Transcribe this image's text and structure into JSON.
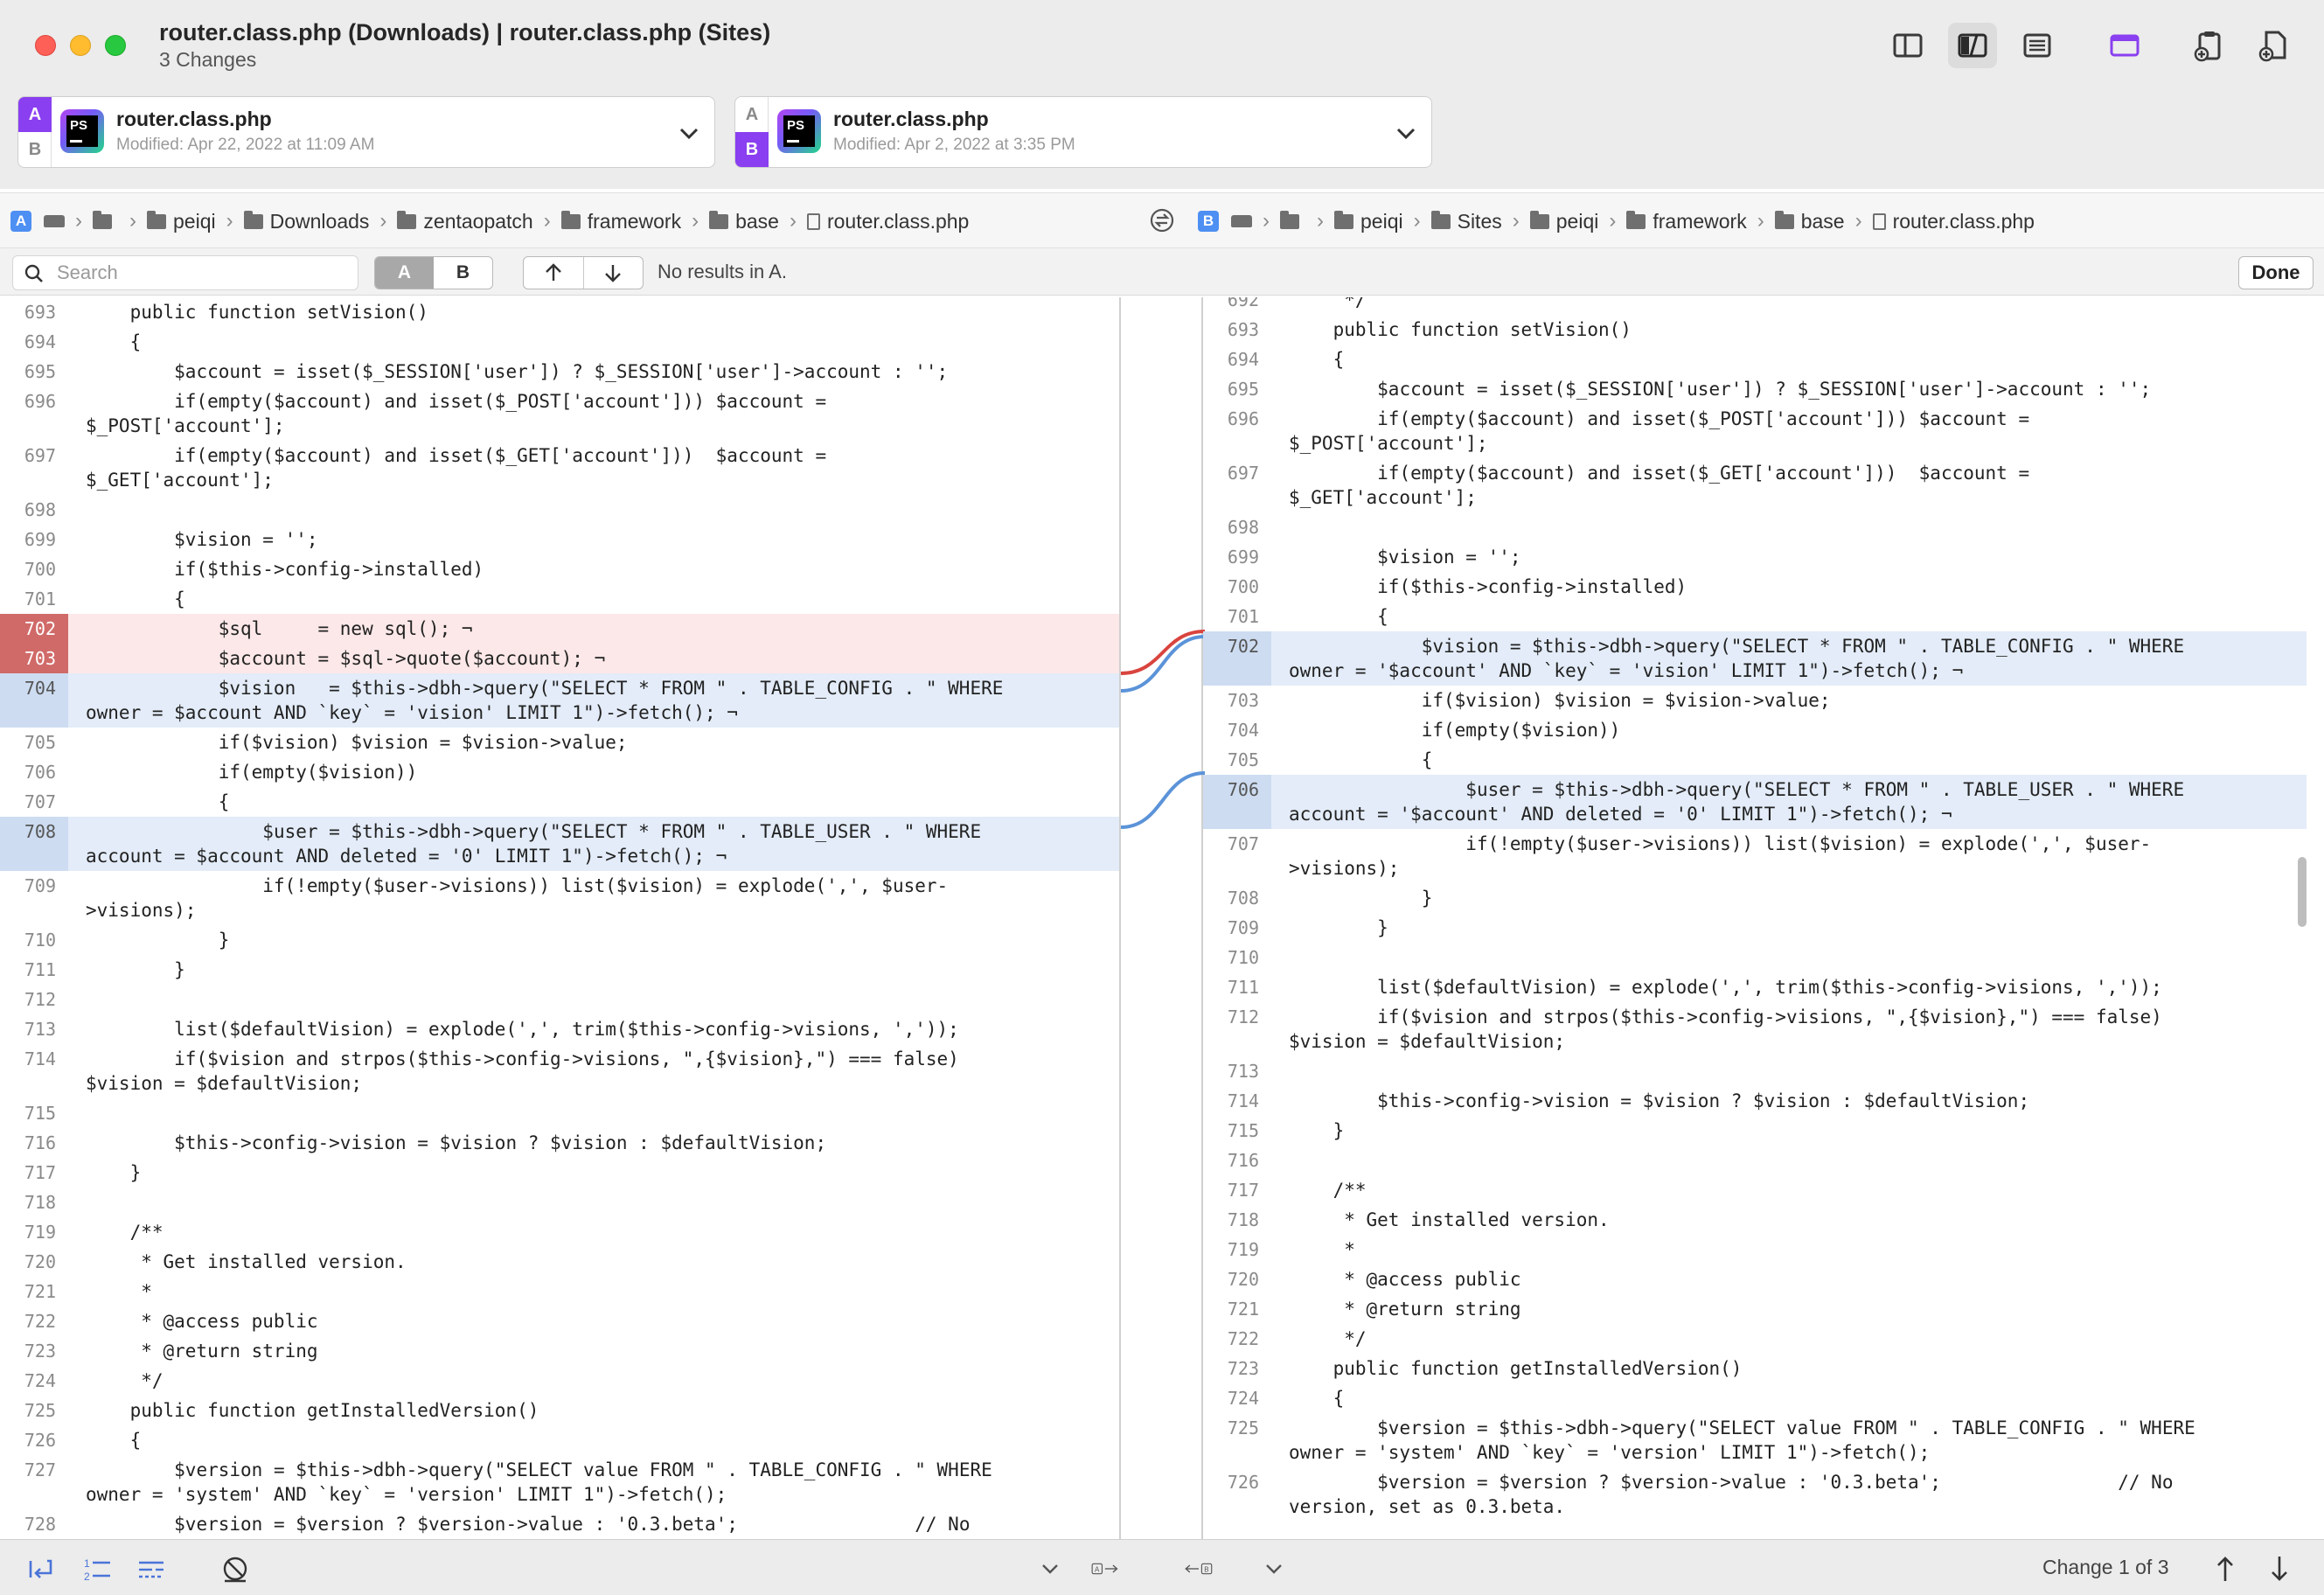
{
  "window": {
    "title": "router.class.php (Downloads) | router.class.php (Sites)",
    "subtitle": "3 Changes"
  },
  "toolbar": {
    "icons": [
      "sidebar-layout-icon",
      "side-by-side-layout-icon",
      "unified-layout-icon",
      "window-layout-icon",
      "clipboard-add-icon",
      "document-add-icon"
    ]
  },
  "file_a": {
    "name": "router.class.php",
    "modified": "Modified: Apr 22, 2022 at 11:09 AM",
    "selected": "A"
  },
  "file_b": {
    "name": "router.class.php",
    "modified": "Modified: Apr 2, 2022 at 3:35 PM",
    "selected": "B"
  },
  "path_a": {
    "badge": "A",
    "crumbs": [
      "peiqi",
      "Downloads",
      "zentaopatch",
      "framework",
      "base",
      "router.class.php"
    ]
  },
  "path_b": {
    "badge": "B",
    "crumbs": [
      "peiqi",
      "Sites",
      "peiqi",
      "framework",
      "base",
      "router.class.php"
    ]
  },
  "search": {
    "placeholder": "Search",
    "seg_a": "A",
    "seg_b": "B",
    "status": "No results in A.",
    "done_label": "Done"
  },
  "pane_a": [
    {
      "n": "693",
      "t": "    public function setVision()"
    },
    {
      "n": "694",
      "t": "    {"
    },
    {
      "n": "695",
      "t": "        $account = isset($_SESSION['user']) ? $_SESSION['user']->account : '';"
    },
    {
      "n": "696",
      "t": "        if(empty($account) and isset($_POST['account'])) $account =\n$_POST['account'];"
    },
    {
      "n": "697",
      "t": "        if(empty($account) and isset($_GET['account']))  $account =\n$_GET['account'];"
    },
    {
      "n": "698",
      "t": ""
    },
    {
      "n": "699",
      "t": "        $vision = '';"
    },
    {
      "n": "700",
      "t": "        if($this->config->installed)"
    },
    {
      "n": "701",
      "t": "        {"
    },
    {
      "n": "702",
      "t": "            $sql     = new sql(); ¬",
      "k": "del"
    },
    {
      "n": "703",
      "t": "            $account = $sql->quote($account); ¬",
      "k": "del"
    },
    {
      "n": "704",
      "t": "            $vision   = $this->dbh->query(\"SELECT * FROM \" . TABLE_CONFIG . \" WHERE\nowner = $account AND `key` = 'vision' LIMIT 1\")->fetch(); ¬",
      "k": "chg"
    },
    {
      "n": "705",
      "t": "            if($vision) $vision = $vision->value;"
    },
    {
      "n": "706",
      "t": "            if(empty($vision))"
    },
    {
      "n": "707",
      "t": "            {"
    },
    {
      "n": "708",
      "t": "                $user = $this->dbh->query(\"SELECT * FROM \" . TABLE_USER . \" WHERE\naccount = $account AND deleted = '0' LIMIT 1\")->fetch(); ¬",
      "k": "chg"
    },
    {
      "n": "709",
      "t": "                if(!empty($user->visions)) list($vision) = explode(',', $user-\n>visions);"
    },
    {
      "n": "710",
      "t": "            }"
    },
    {
      "n": "711",
      "t": "        }"
    },
    {
      "n": "712",
      "t": ""
    },
    {
      "n": "713",
      "t": "        list($defaultVision) = explode(',', trim($this->config->visions, ','));"
    },
    {
      "n": "714",
      "t": "        if($vision and strpos($this->config->visions, \",{$vision},\") === false)\n$vision = $defaultVision;"
    },
    {
      "n": "715",
      "t": ""
    },
    {
      "n": "716",
      "t": "        $this->config->vision = $vision ? $vision : $defaultVision;"
    },
    {
      "n": "717",
      "t": "    }"
    },
    {
      "n": "718",
      "t": ""
    },
    {
      "n": "719",
      "t": "    /**"
    },
    {
      "n": "720",
      "t": "     * Get installed version."
    },
    {
      "n": "721",
      "t": "     *"
    },
    {
      "n": "722",
      "t": "     * @access public"
    },
    {
      "n": "723",
      "t": "     * @return string"
    },
    {
      "n": "724",
      "t": "     */"
    },
    {
      "n": "725",
      "t": "    public function getInstalledVersion()"
    },
    {
      "n": "726",
      "t": "    {"
    },
    {
      "n": "727",
      "t": "        $version = $this->dbh->query(\"SELECT value FROM \" . TABLE_CONFIG . \" WHERE\nowner = 'system' AND `key` = 'version' LIMIT 1\")->fetch();"
    },
    {
      "n": "728",
      "t": "        $version = $version ? $version->value : '0.3.beta';                // No"
    }
  ],
  "pane_b": [
    {
      "n": "692",
      "t": "     */"
    },
    {
      "n": "693",
      "t": "    public function setVision()"
    },
    {
      "n": "694",
      "t": "    {"
    },
    {
      "n": "695",
      "t": "        $account = isset($_SESSION['user']) ? $_SESSION['user']->account : '';"
    },
    {
      "n": "696",
      "t": "        if(empty($account) and isset($_POST['account'])) $account =\n$_POST['account'];"
    },
    {
      "n": "697",
      "t": "        if(empty($account) and isset($_GET['account']))  $account =\n$_GET['account'];"
    },
    {
      "n": "698",
      "t": ""
    },
    {
      "n": "699",
      "t": "        $vision = '';"
    },
    {
      "n": "700",
      "t": "        if($this->config->installed)"
    },
    {
      "n": "701",
      "t": "        {"
    },
    {
      "n": "702",
      "t": "            $vision = $this->dbh->query(\"SELECT * FROM \" . TABLE_CONFIG . \" WHERE\nowner = '$account' AND `key` = 'vision' LIMIT 1\")->fetch(); ¬",
      "k": "chg"
    },
    {
      "n": "703",
      "t": "            if($vision) $vision = $vision->value;"
    },
    {
      "n": "704",
      "t": "            if(empty($vision))"
    },
    {
      "n": "705",
      "t": "            {"
    },
    {
      "n": "706",
      "t": "                $user = $this->dbh->query(\"SELECT * FROM \" . TABLE_USER . \" WHERE\naccount = '$account' AND deleted = '0' LIMIT 1\")->fetch(); ¬",
      "k": "chg"
    },
    {
      "n": "707",
      "t": "                if(!empty($user->visions)) list($vision) = explode(',', $user-\n>visions);"
    },
    {
      "n": "708",
      "t": "            }"
    },
    {
      "n": "709",
      "t": "        }"
    },
    {
      "n": "710",
      "t": ""
    },
    {
      "n": "711",
      "t": "        list($defaultVision) = explode(',', trim($this->config->visions, ','));"
    },
    {
      "n": "712",
      "t": "        if($vision and strpos($this->config->visions, \",{$vision},\") === false)\n$vision = $defaultVision;"
    },
    {
      "n": "713",
      "t": ""
    },
    {
      "n": "714",
      "t": "        $this->config->vision = $vision ? $vision : $defaultVision;"
    },
    {
      "n": "715",
      "t": "    }"
    },
    {
      "n": "716",
      "t": ""
    },
    {
      "n": "717",
      "t": "    /**"
    },
    {
      "n": "718",
      "t": "     * Get installed version."
    },
    {
      "n": "719",
      "t": "     *"
    },
    {
      "n": "720",
      "t": "     * @access public"
    },
    {
      "n": "721",
      "t": "     * @return string"
    },
    {
      "n": "722",
      "t": "     */"
    },
    {
      "n": "723",
      "t": "    public function getInstalledVersion()"
    },
    {
      "n": "724",
      "t": "    {"
    },
    {
      "n": "725",
      "t": "        $version = $this->dbh->query(\"SELECT value FROM \" . TABLE_CONFIG . \" WHERE\nowner = 'system' AND `key` = 'version' LIMIT 1\")->fetch();"
    },
    {
      "n": "726",
      "t": "        $version = $version ? $version->value : '0.3.beta';                // No\nversion, set as 0.3.beta."
    }
  ],
  "status": {
    "change_label": "Change 1 of 3"
  },
  "colors": {
    "deleted_bg": "#fce8e8",
    "deleted_gutter": "#d06a68",
    "changed_bg": "#e3ecf8",
    "connector_red": "#d9443e",
    "connector_blue": "#5b93d8",
    "accent_purple": "#8a3ff0"
  }
}
